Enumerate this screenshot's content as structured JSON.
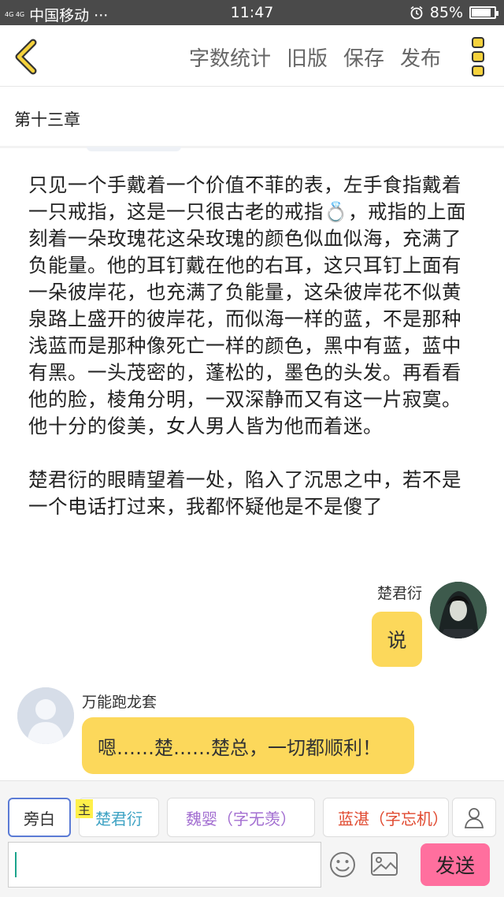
{
  "status_bar": {
    "signal": "4G 4G",
    "carrier": "中国移动 ···",
    "time": "11:47",
    "battery_percent": "85%",
    "battery_level": 0.85
  },
  "toolbar": {
    "word_count": "字数统计",
    "old_version": "旧版",
    "save": "保存",
    "publish": "发布"
  },
  "chapter": {
    "title": "第十三章"
  },
  "content": {
    "paragraph_1": "只见一个手戴着一个价值不菲的表，左手食指戴着一只戒指，这是一只很古老的戒指💍，戒指的上面刻着一朵玫瑰花这朵玫瑰的颜色似血似海，充满了负能量。他的耳钉戴在他的右耳，这只耳钉上面有一朵彼岸花，也充满了负能量，这朵彼岸花不似黄泉路上盛开的彼岸花，而似海一样的蓝，不是那种浅蓝而是那种像死亡一样的颜色，黑中有蓝，蓝中有黑。一头茂密的，蓬松的，墨色的头发。再看看他的脸，棱角分明，一双深静而又有这一片寂寞。他十分的俊美，女人男人皆为他而着迷。",
    "paragraph_2": "楚君衍的眼睛望着一处，陷入了沉思之中，若不是一个电话打过来，我都怀疑他是不是傻了"
  },
  "chat": {
    "right_name": "楚君衍",
    "right_message": "说",
    "left_name": "万能跑龙套",
    "left_message": "嗯……楚……楚总，一切都顺利！"
  },
  "characters": {
    "narration": "旁白",
    "main_tag": "主",
    "char_1": "楚君衍",
    "char_2": "魏婴（字无羡）",
    "char_3": "蓝湛（字忘机）"
  },
  "composer": {
    "input_value": "",
    "send_label": "发送"
  },
  "colors": {
    "accent_yellow": "#fcd85b",
    "send_pink": "#ff6f9e",
    "narration_border": "#5b7bd5"
  }
}
